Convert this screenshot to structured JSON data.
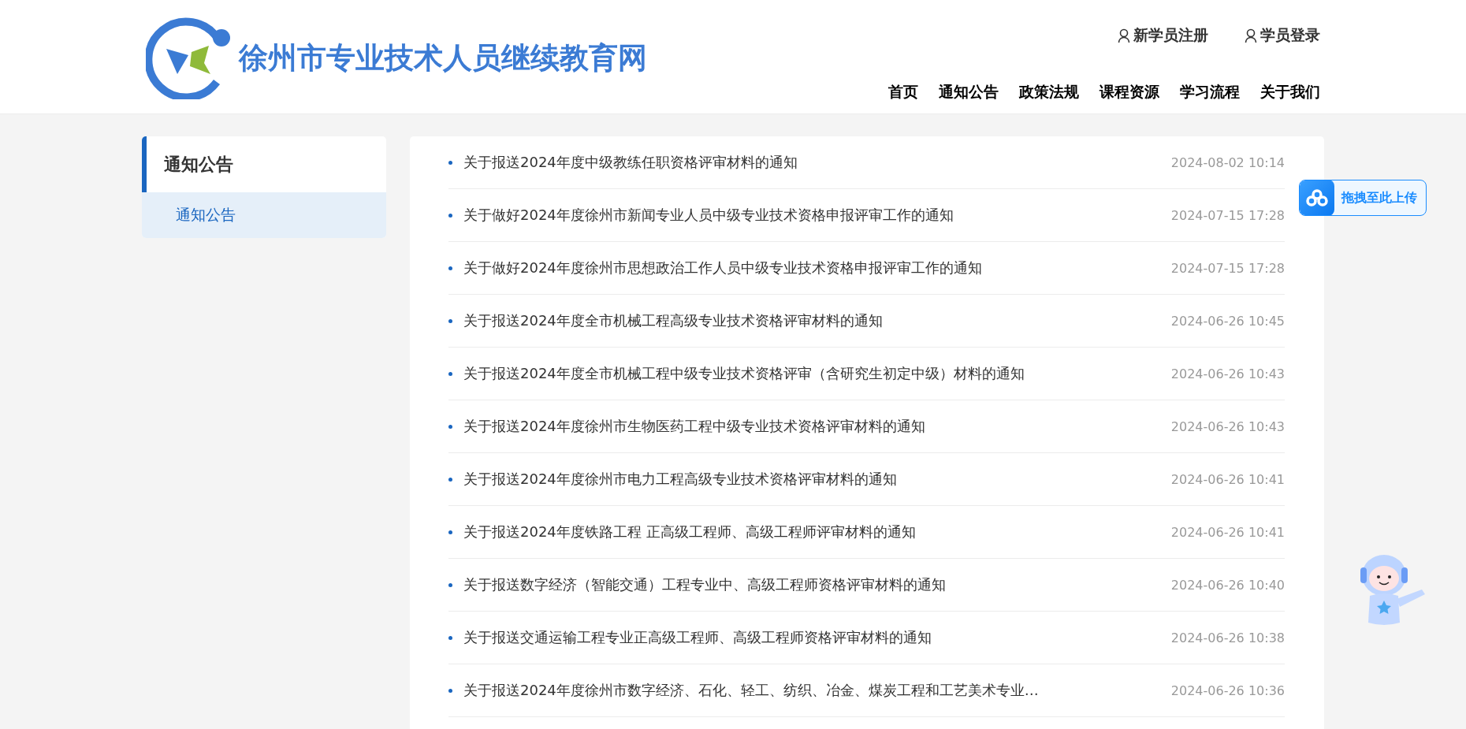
{
  "header": {
    "site_title": "徐州市专业技术人员继续教育网",
    "account_links": [
      "新学员注册",
      "学员登录"
    ],
    "nav": [
      {
        "label": "首页",
        "selected": false
      },
      {
        "label": "通知公告",
        "selected": false
      },
      {
        "label": "政策法规",
        "selected": false
      },
      {
        "label": "课程资源",
        "selected": false
      },
      {
        "label": "学习流程",
        "selected": false
      },
      {
        "label": "关于我们",
        "selected": false
      }
    ]
  },
  "sidebar": {
    "title": "通知公告",
    "items": [
      {
        "label": "通知公告",
        "selected": true
      }
    ]
  },
  "notices": [
    {
      "title": "关于报送2024年度中级教练任职资格评审材料的通知",
      "date": "2024-08-02 10:14"
    },
    {
      "title": "关于做好2024年度徐州市新闻专业人员中级专业技术资格申报评审工作的通知",
      "date": "2024-07-15 17:28"
    },
    {
      "title": "关于做好2024年度徐州市思想政治工作人员中级专业技术资格申报评审工作的通知",
      "date": "2024-07-15 17:28"
    },
    {
      "title": "关于报送2024年度全市机械工程高级专业技术资格评审材料的通知",
      "date": "2024-06-26 10:45"
    },
    {
      "title": "关于报送2024年度全市机械工程中级专业技术资格评审（含研究生初定中级）材料的通知",
      "date": "2024-06-26 10:43"
    },
    {
      "title": "关于报送2024年度徐州市生物医药工程中级专业技术资格评审材料的通知",
      "date": "2024-06-26 10:43"
    },
    {
      "title": "关于报送2024年度徐州市电力工程高级专业技术资格评审材料的通知",
      "date": "2024-06-26 10:41"
    },
    {
      "title": "关于报送2024年度铁路工程 正高级工程师、高级工程师评审材料的通知",
      "date": "2024-06-26 10:41"
    },
    {
      "title": "关于报送数字经济（智能交通）工程专业中、高级工程师资格评审材料的通知",
      "date": "2024-06-26 10:40"
    },
    {
      "title": "关于报送交通运输工程专业正高级工程师、高级工程师资格评审材料的通知",
      "date": "2024-06-26 10:38"
    },
    {
      "title": "关于报送2024年度徐州市数字经济、石化、轻工、纺织、冶金、煤炭工程和工艺美术专业…",
      "date": "2024-06-26 10:36"
    }
  ],
  "upload_widget": {
    "label": "拖拽至此上传"
  }
}
